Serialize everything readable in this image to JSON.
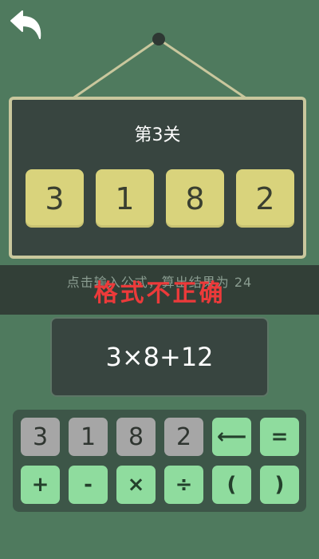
{
  "header": {
    "back_icon": "undo-arrow-icon"
  },
  "board": {
    "level_title": "第3关",
    "numbers": [
      "3",
      "1",
      "8",
      "2"
    ]
  },
  "banner": {
    "hint": "点击输入公式，算出结果为 24",
    "error": "格式不正确"
  },
  "formula": {
    "value": "3×8+12"
  },
  "keypad": {
    "number_keys": [
      "3",
      "1",
      "8",
      "2"
    ],
    "backspace_label": "⟵",
    "equals_label": "=",
    "operator_keys": [
      "+",
      "-",
      "×",
      "÷",
      "(",
      ")"
    ]
  },
  "colors": {
    "background": "#4f7a5e",
    "board": "#384540",
    "board_border": "#c9c79d",
    "number_card": "#d9d37c",
    "number_key": "#a6a6a6",
    "operator_key": "#8fdc9e",
    "error": "#ec3a3a"
  }
}
